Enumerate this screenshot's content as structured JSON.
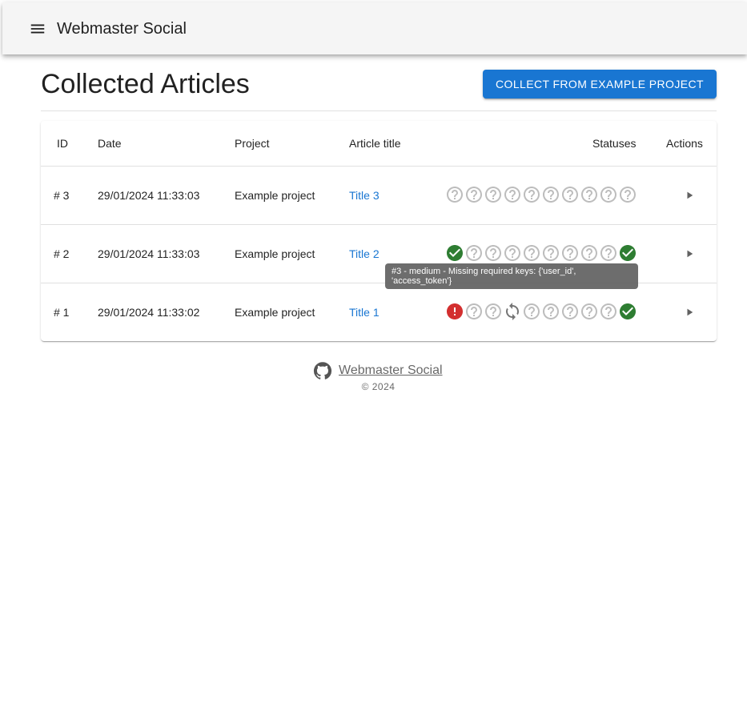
{
  "appbar": {
    "title": "Webmaster Social",
    "menu_icon": "hamburger-menu-icon"
  },
  "page": {
    "title": "Collected Articles",
    "collect_button": "Collect from Example project"
  },
  "table": {
    "headers": {
      "id": "ID",
      "date": "Date",
      "project": "Project",
      "title": "Article title",
      "statuses": "Statuses",
      "actions": "Actions"
    },
    "rows": [
      {
        "id": "# 3",
        "date": "29/01/2024 11:33:03",
        "project": "Example project",
        "title": "Title 3",
        "statuses": [
          "unknown",
          "unknown",
          "unknown",
          "unknown",
          "unknown",
          "unknown",
          "unknown",
          "unknown",
          "unknown",
          "unknown"
        ]
      },
      {
        "id": "# 2",
        "date": "29/01/2024 11:33:03",
        "project": "Example project",
        "title": "Title 2",
        "statuses": [
          "success",
          "unknown",
          "unknown",
          "unknown",
          "unknown",
          "unknown",
          "unknown",
          "unknown",
          "unknown",
          "success"
        ]
      },
      {
        "id": "# 1",
        "date": "29/01/2024 11:33:02",
        "project": "Example project",
        "title": "Title 1",
        "statuses": [
          "error",
          "unknown",
          "unknown",
          "sync",
          "unknown",
          "unknown",
          "unknown",
          "unknown",
          "unknown",
          "success"
        ]
      }
    ]
  },
  "tooltip": {
    "text": "#3 - medium - Missing required keys: {'user_id', 'access_token'}"
  },
  "footer": {
    "link_text": "Webmaster Social",
    "copyright": "© 2024",
    "icon": "github-icon"
  },
  "colors": {
    "primary": "#1976d2",
    "success": "#2e7d32",
    "error": "#d32f2f",
    "unknown": "#bdbdbd",
    "sync": "#757575"
  }
}
